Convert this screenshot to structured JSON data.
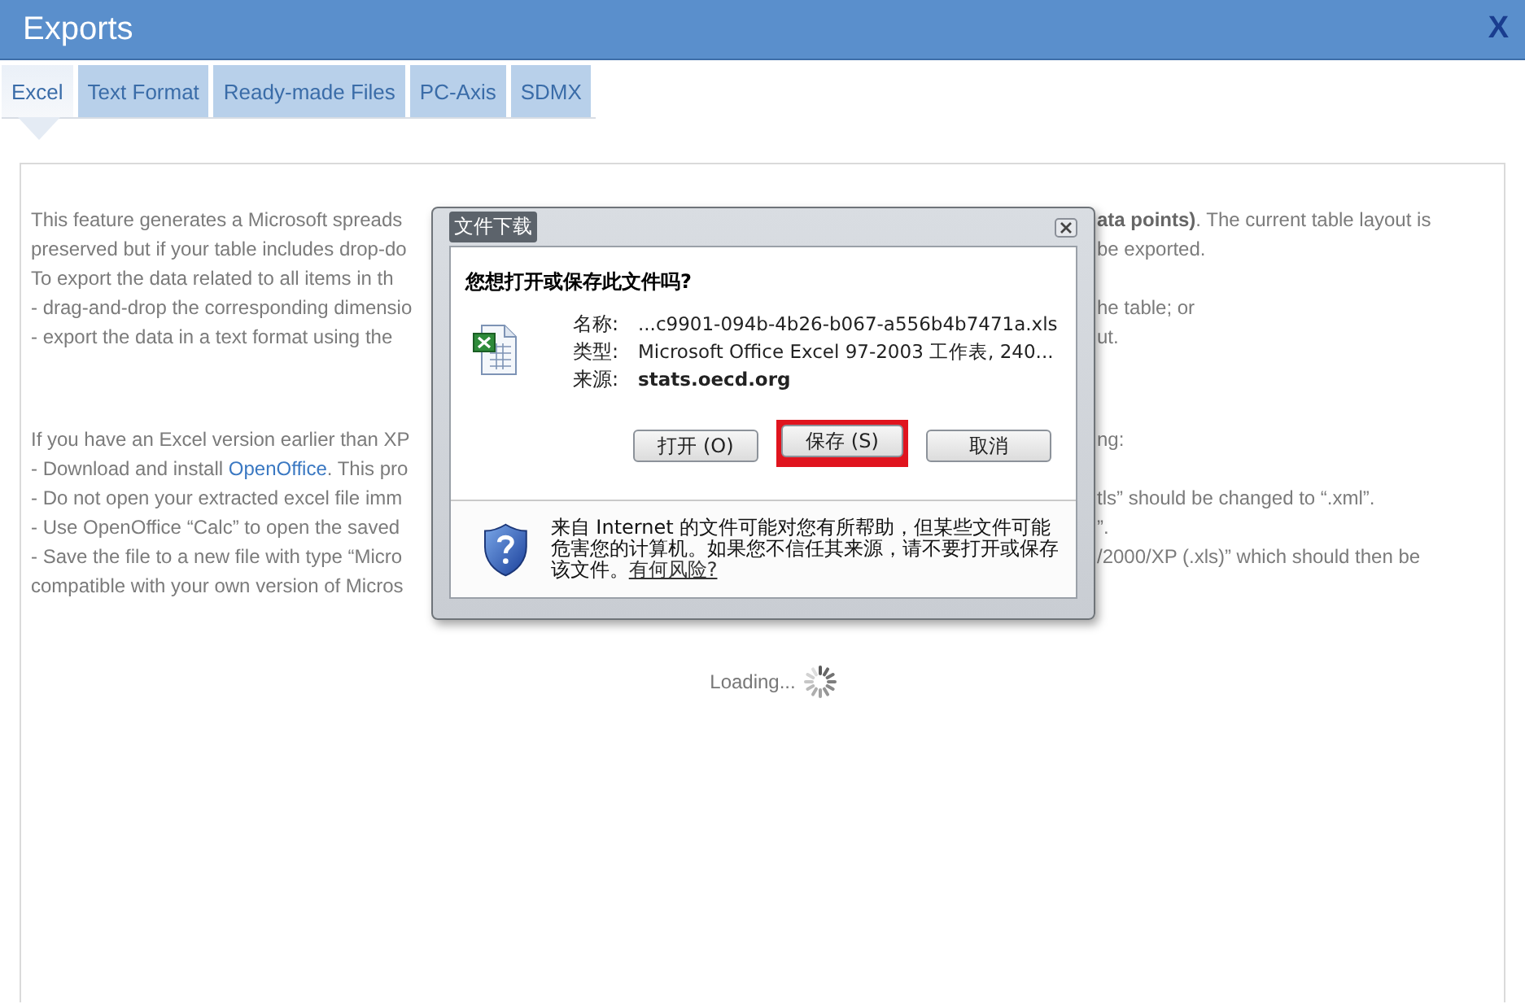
{
  "window": {
    "title": "Exports",
    "close": "X"
  },
  "tabs": [
    {
      "label": "Excel",
      "selected": true
    },
    {
      "label": "Text Format",
      "selected": false
    },
    {
      "label": "Ready-made Files",
      "selected": false
    },
    {
      "label": "PC-Axis",
      "selected": false
    },
    {
      "label": "SDMX",
      "selected": false
    }
  ],
  "paragraphs": [
    {
      "lines": [
        {
          "left": "This feature generates a Microsoft spreads",
          "right": "**ata points)**. The current table layout is"
        },
        {
          "left": "preserved but if your table includes drop-do",
          "right": "be exported."
        },
        {
          "left": "To export the data related to all items in th"
        },
        {
          "left": "- drag-and-drop the corresponding dimensio",
          "right": "he table; or"
        },
        {
          "left": "- export the data in a text format using the",
          "right": "ut."
        }
      ]
    },
    {
      "lines": [
        {
          "left": "If you have an Excel version earlier than XP",
          "right": "ng:"
        },
        {
          "left": "- Download and install ",
          "link": "OpenOffice",
          "left_end": ". This pro"
        },
        {
          "left": "- Do not open your extracted excel file imm",
          "right": "tls” should be changed to “.xml”."
        },
        {
          "left": "- Use OpenOffice “Calc” to open the saved",
          "right": "”."
        },
        {
          "left": "- Save the file to a new file with type “Micro",
          "right": "/2000/XP (.xls)” which should then be"
        },
        {
          "left": "compatible with your own version of Micros"
        }
      ]
    }
  ],
  "loading": "Loading...",
  "dialog": {
    "title": "文件下载",
    "heading": "您想打开或保存此文件吗?",
    "fields": [
      {
        "label": "名称:",
        "value": "...c9901-094b-4b26-b067-a556b4b7471a.xls",
        "bold": false
      },
      {
        "label": "类型:",
        "value": "Microsoft Office Excel 97-2003 工作表, 240...",
        "bold": false
      },
      {
        "label": "来源:",
        "value": "stats.oecd.org",
        "bold": true
      }
    ],
    "buttons": [
      {
        "label": "打开 (O)",
        "highlighted": false
      },
      {
        "label": "保存 (S)",
        "highlighted": true
      },
      {
        "label": "取消",
        "highlighted": false
      }
    ],
    "warning": "来自 Internet 的文件可能对您有所帮助，但某些文件可能危害您的计算机。如果您不信任其来源，请不要打开或保存该文件。",
    "warning_link": "有何风险?"
  }
}
